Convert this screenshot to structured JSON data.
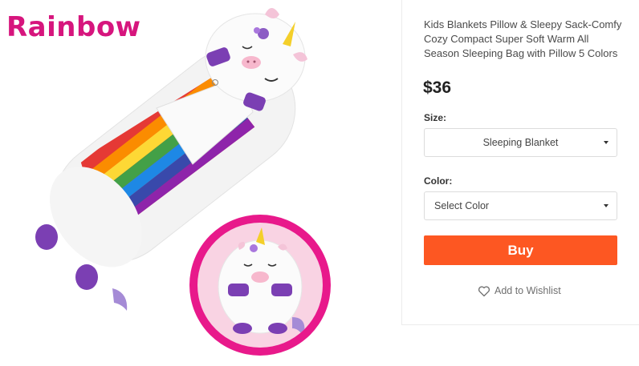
{
  "image": {
    "brand_label": "Rainbow",
    "colors": {
      "brand_pink": "#d6157d",
      "ring_pink": "#e8198b",
      "accent_purple": "#7b3fb3",
      "horn_yellow": "#f4cf2a"
    }
  },
  "product": {
    "title": "Kids Blankets Pillow & Sleepy Sack-Comfy Cozy Compact Super Soft Warm All Season Sleeping Bag with Pillow 5 Colors",
    "price": "$36"
  },
  "options": {
    "size_label": "Size:",
    "size_selected": "Sleeping Blanket",
    "color_label": "Color:",
    "color_selected": "Select Color"
  },
  "actions": {
    "buy_label": "Buy",
    "wishlist_label": "Add to Wishlist",
    "buy_color": "#fd5722"
  },
  "icons": {
    "caret": "chevron-down-icon",
    "wishlist": "heart-icon"
  }
}
